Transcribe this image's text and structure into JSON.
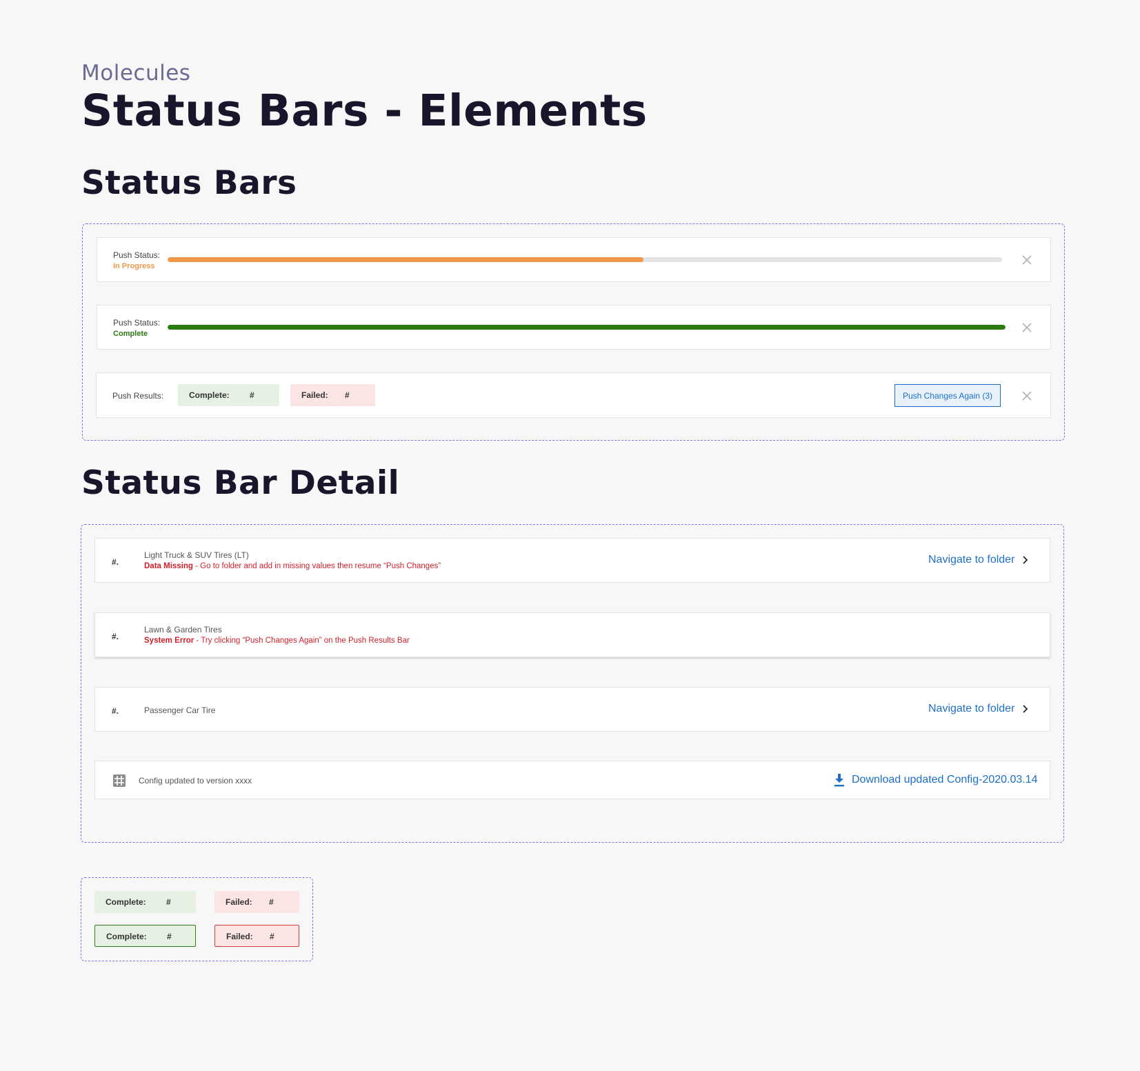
{
  "header": {
    "eyebrow": "Molecules",
    "title": "Status Bars - Elements"
  },
  "colors": {
    "in_progress": "#f0974a",
    "complete": "#2a7a12",
    "error": "#d0212b",
    "link": "#1c6fc4",
    "frame": "#7b74e8"
  },
  "status_bars": {
    "section_title": "Status Bars",
    "in_progress_bar": {
      "label": "Push Status:",
      "status": "In Progress",
      "progress_percent": 57
    },
    "complete_bar": {
      "label": "Push Status:",
      "status": "Complete",
      "progress_percent": 100
    },
    "results_bar": {
      "label": "Push Results:",
      "complete_label": "Complete:",
      "complete_count": "#",
      "failed_label": "Failed:",
      "failed_count": "#",
      "button_label": "Push Changes Again (3)"
    },
    "close_icon": "close-icon"
  },
  "detail": {
    "section_title": "Status Bar Detail",
    "rows": [
      {
        "num": "#.",
        "title": "Light Truck & SUV Tires (LT)",
        "error_type": "Data Missing",
        "error_msg": " - Go to folder and add in missing values then resume “Push Changes”",
        "action": "Navigate to folder"
      },
      {
        "num": "#.",
        "title": "Lawn & Garden Tires",
        "error_type": "System Error",
        "error_msg": " - Try clicking “Push Changes Again” on the Push Results Bar",
        "action": ""
      },
      {
        "num": "#.",
        "title": "Passenger Car Tire",
        "error_type": "",
        "error_msg": "",
        "action": "Navigate to folder"
      }
    ],
    "config_row": {
      "icon": "grid-icon",
      "text": "Config updated to version xxxx",
      "download_icon": "download-icon",
      "download_label": "Download updated Config-2020.03.14"
    }
  },
  "pill_states": {
    "complete_label": "Complete:",
    "complete_count": "#",
    "failed_label": "Failed:",
    "failed_count": "#"
  }
}
